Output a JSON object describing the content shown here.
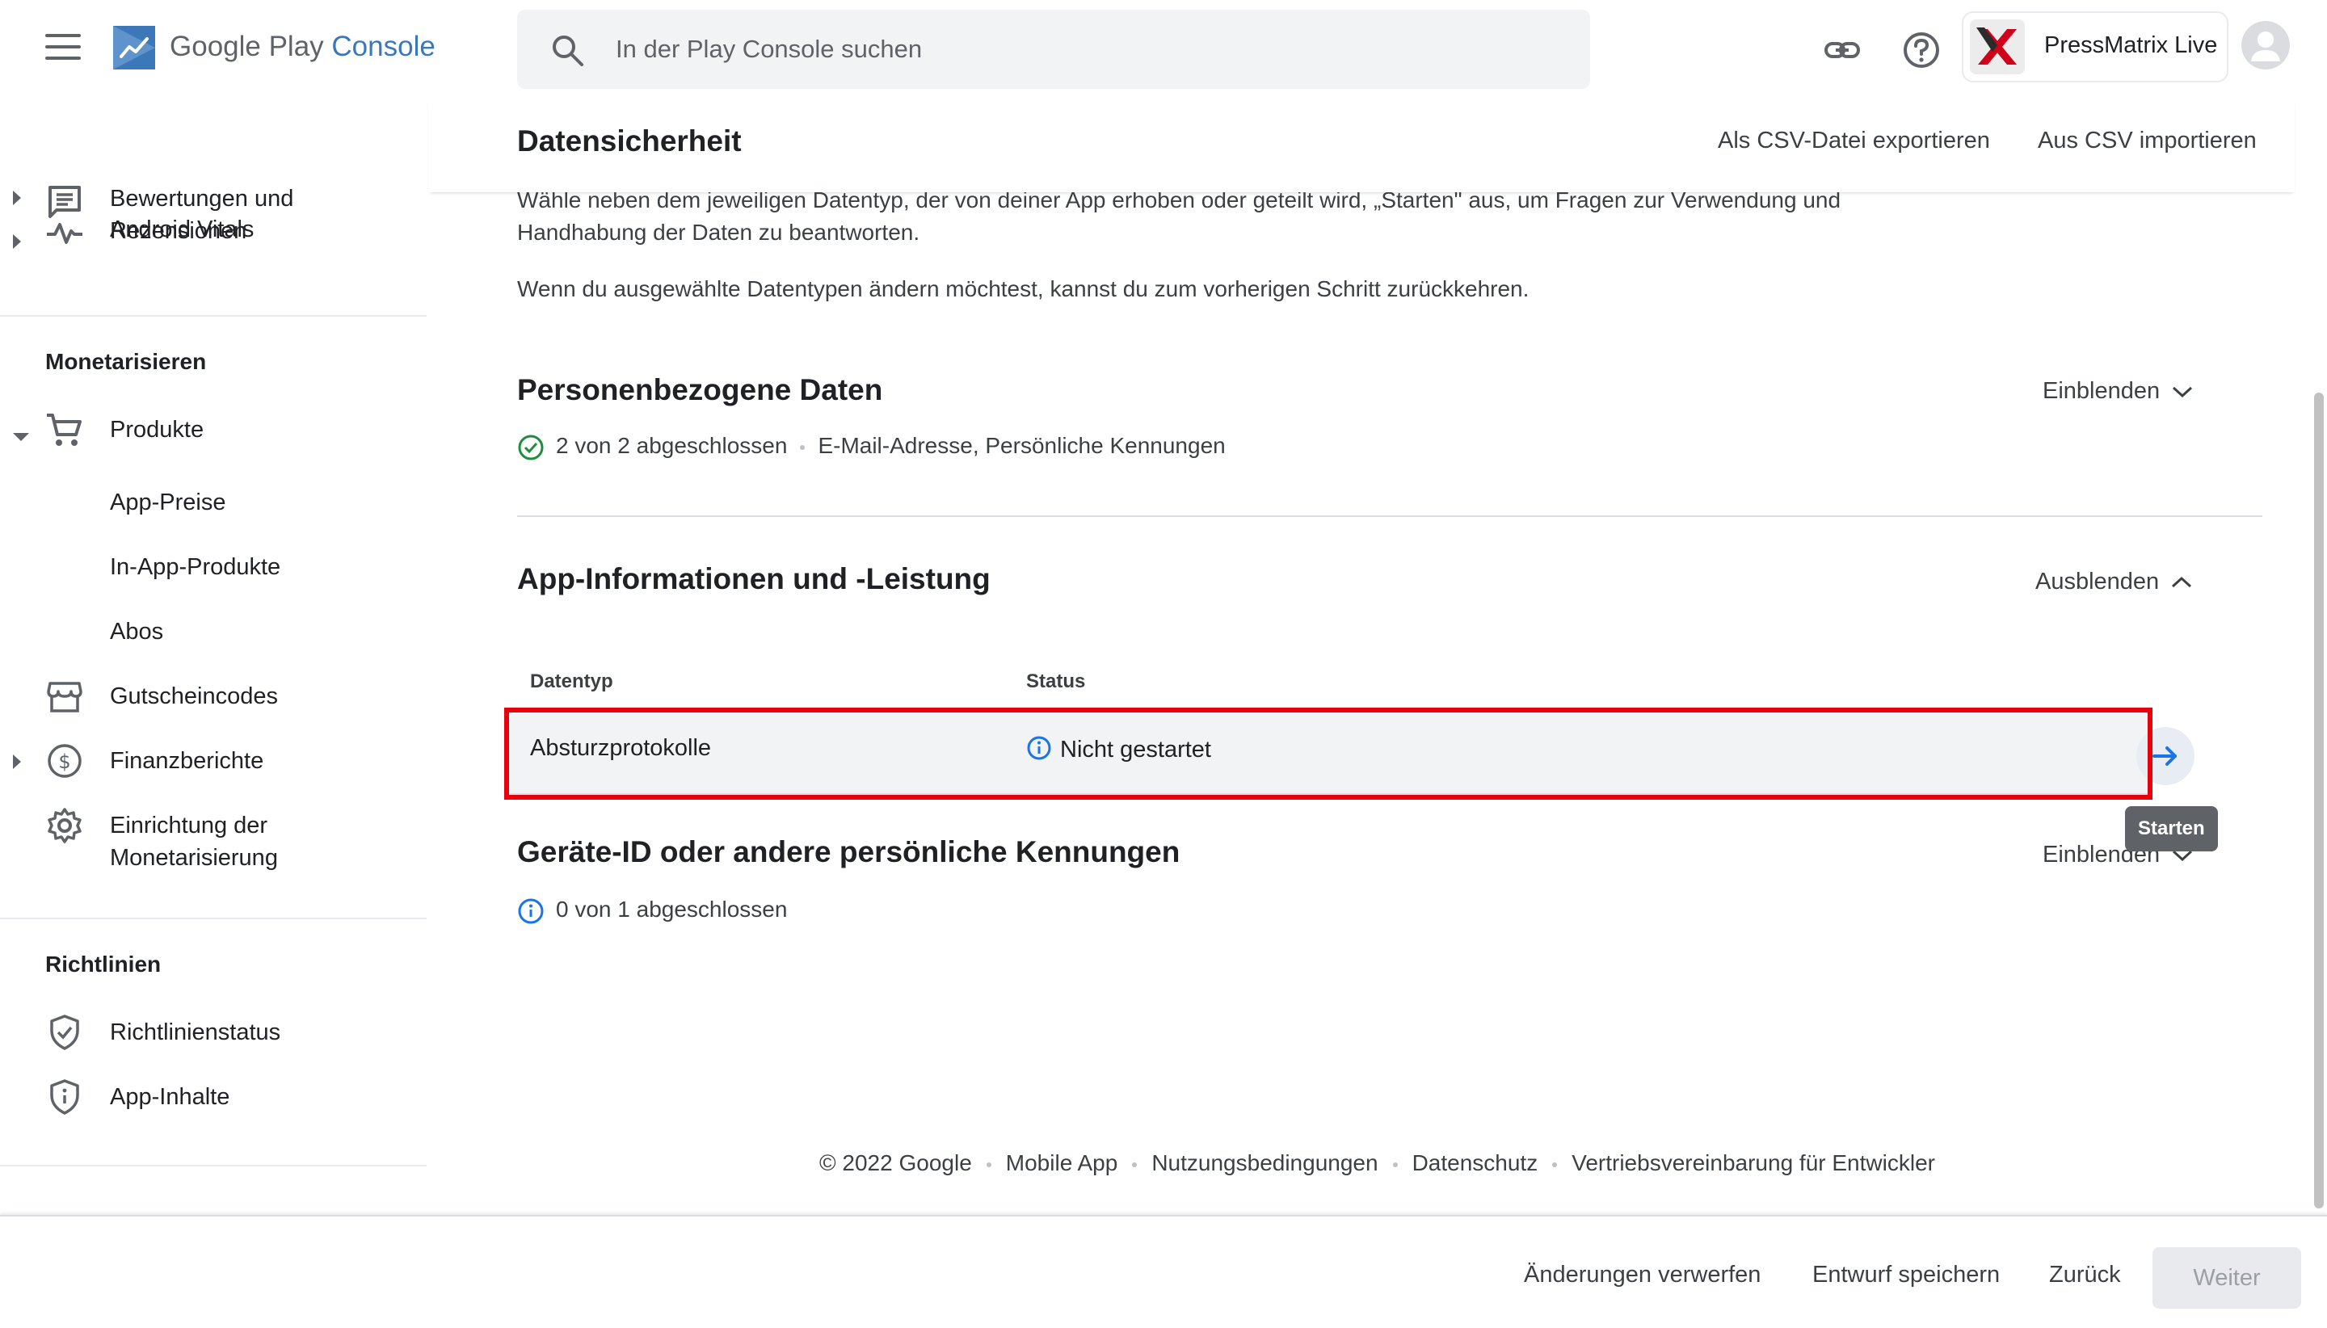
{
  "header": {
    "product_name_prefix": "Google Play ",
    "product_name_suffix": "Console",
    "search_placeholder": "In der Play Console suchen",
    "app_name": "PressMatrix Live"
  },
  "sidebar": {
    "items_top": [
      {
        "label": "Bewertungen und Rezensionen",
        "icon": "reviews-icon"
      },
      {
        "label": "Android Vitals",
        "icon": "vitals-icon"
      }
    ],
    "section_monetize": "Monetarisieren",
    "produkte": "Produkte",
    "sub_items": [
      "App-Preise",
      "In-App-Produkte",
      "Abos"
    ],
    "gutscheincodes": "Gutscheincodes",
    "finanzberichte": "Finanzberichte",
    "einrichtung": "Einrichtung der Monetarisierung",
    "section_policies": "Richtlinien",
    "richtlinienstatus": "Richtlinienstatus",
    "app_inhalte": "App-Inhalte"
  },
  "page": {
    "title": "Datensicherheit",
    "export_csv": "Als CSV-Datei exportieren",
    "import_csv": "Aus CSV importieren",
    "intro_1": "Wähle neben dem jeweiligen Datentyp, der von deiner App erhoben oder geteilt wird, „Starten\" aus, um Fragen zur Verwendung und Handhabung der Daten zu beantworten.",
    "intro_2": "Wenn du ausgewählte Datentypen ändern möchtest, kannst du zum vorherigen Schritt zurückkehren."
  },
  "groups": {
    "personal": {
      "title": "Personenbezogene Daten",
      "toggle": "Einblenden",
      "progress": "2 von 2 abgeschlossen",
      "types": "E-Mail-Adresse, Persönliche Kennungen"
    },
    "app_info": {
      "title": "App-Informationen und -Leistung",
      "toggle": "Ausblenden",
      "col_type": "Datentyp",
      "col_status": "Status",
      "row_type": "Absturzprotokolle",
      "row_status": "Nicht gestartet",
      "start_tooltip": "Starten"
    },
    "device_id": {
      "title": "Geräte-ID oder andere persönliche Kennungen",
      "toggle": "Einblenden",
      "progress": "0 von 1 abgeschlossen"
    }
  },
  "footer": {
    "copyright": "© 2022 Google",
    "links": [
      "Mobile App",
      "Nutzungsbedingungen",
      "Datenschutz",
      "Vertriebsvereinbarung für Entwickler"
    ]
  },
  "actions": {
    "discard": "Änderungen verwerfen",
    "save_draft": "Entwurf speichern",
    "back": "Zurück",
    "next": "Weiter"
  },
  "colors": {
    "accent_blue": "#1a73e8",
    "success_green": "#1e8e3e",
    "highlight_red": "#e8000d"
  }
}
